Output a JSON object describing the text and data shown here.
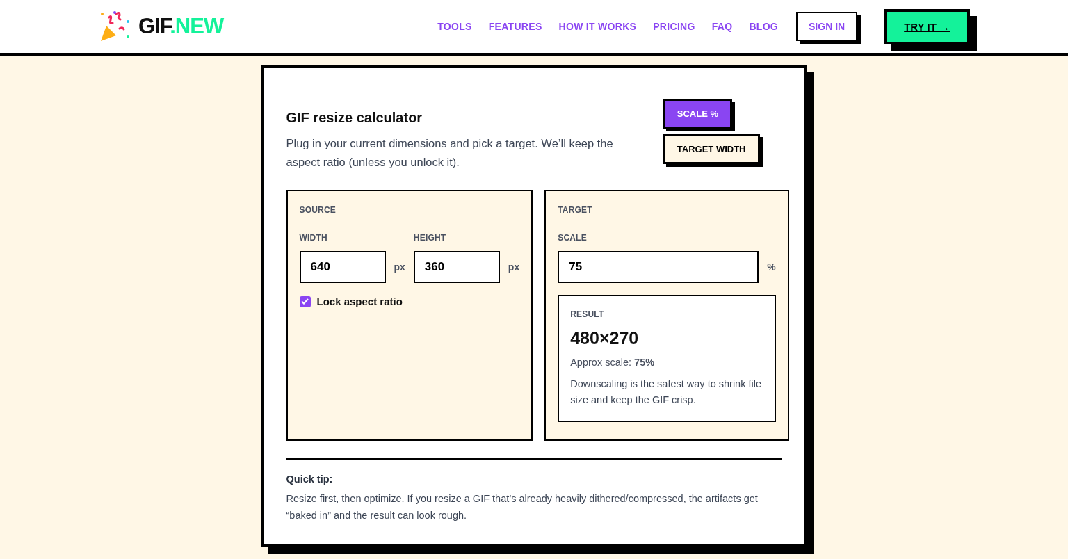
{
  "header": {
    "logo": {
      "main": "GIF",
      "accent": ".NEW"
    },
    "nav": [
      {
        "label": "TOOLS"
      },
      {
        "label": "FEATURES"
      },
      {
        "label": "HOW IT WORKS"
      },
      {
        "label": "PRICING"
      },
      {
        "label": "FAQ"
      },
      {
        "label": "BLOG"
      }
    ],
    "sign_in": "SIGN IN",
    "cta": "TRY IT →"
  },
  "calculator": {
    "title": "GIF resize calculator",
    "description": "Plug in your current dimensions and pick a target. We’ll keep the aspect ratio (unless you unlock it).",
    "modes": [
      {
        "label": "SCALE %",
        "selected": true
      },
      {
        "label": "TARGET WIDTH",
        "selected": false
      }
    ],
    "source": {
      "heading": "SOURCE",
      "fields": [
        {
          "label": "WIDTH",
          "value": "640",
          "unit": "px"
        },
        {
          "label": "HEIGHT",
          "value": "360",
          "unit": "px"
        }
      ],
      "lock": {
        "label": "Lock aspect ratio",
        "checked": true
      }
    },
    "target": {
      "heading": "TARGET",
      "field": {
        "label": "SCALE",
        "value": "75",
        "unit": "%"
      },
      "result": {
        "heading": "RESULT",
        "dimensions": "480×270",
        "approx": "Approx scale: **75%**",
        "note": "Downscaling is the safest way to shrink file size and keep the GIF crisp."
      }
    },
    "tip": {
      "title": "Quick tip:",
      "text": "Resize first, then optimize. If you resize a GIF that’s already heavily dithered/compressed, the artifacts get “baked in” and the result can look rough."
    }
  }
}
